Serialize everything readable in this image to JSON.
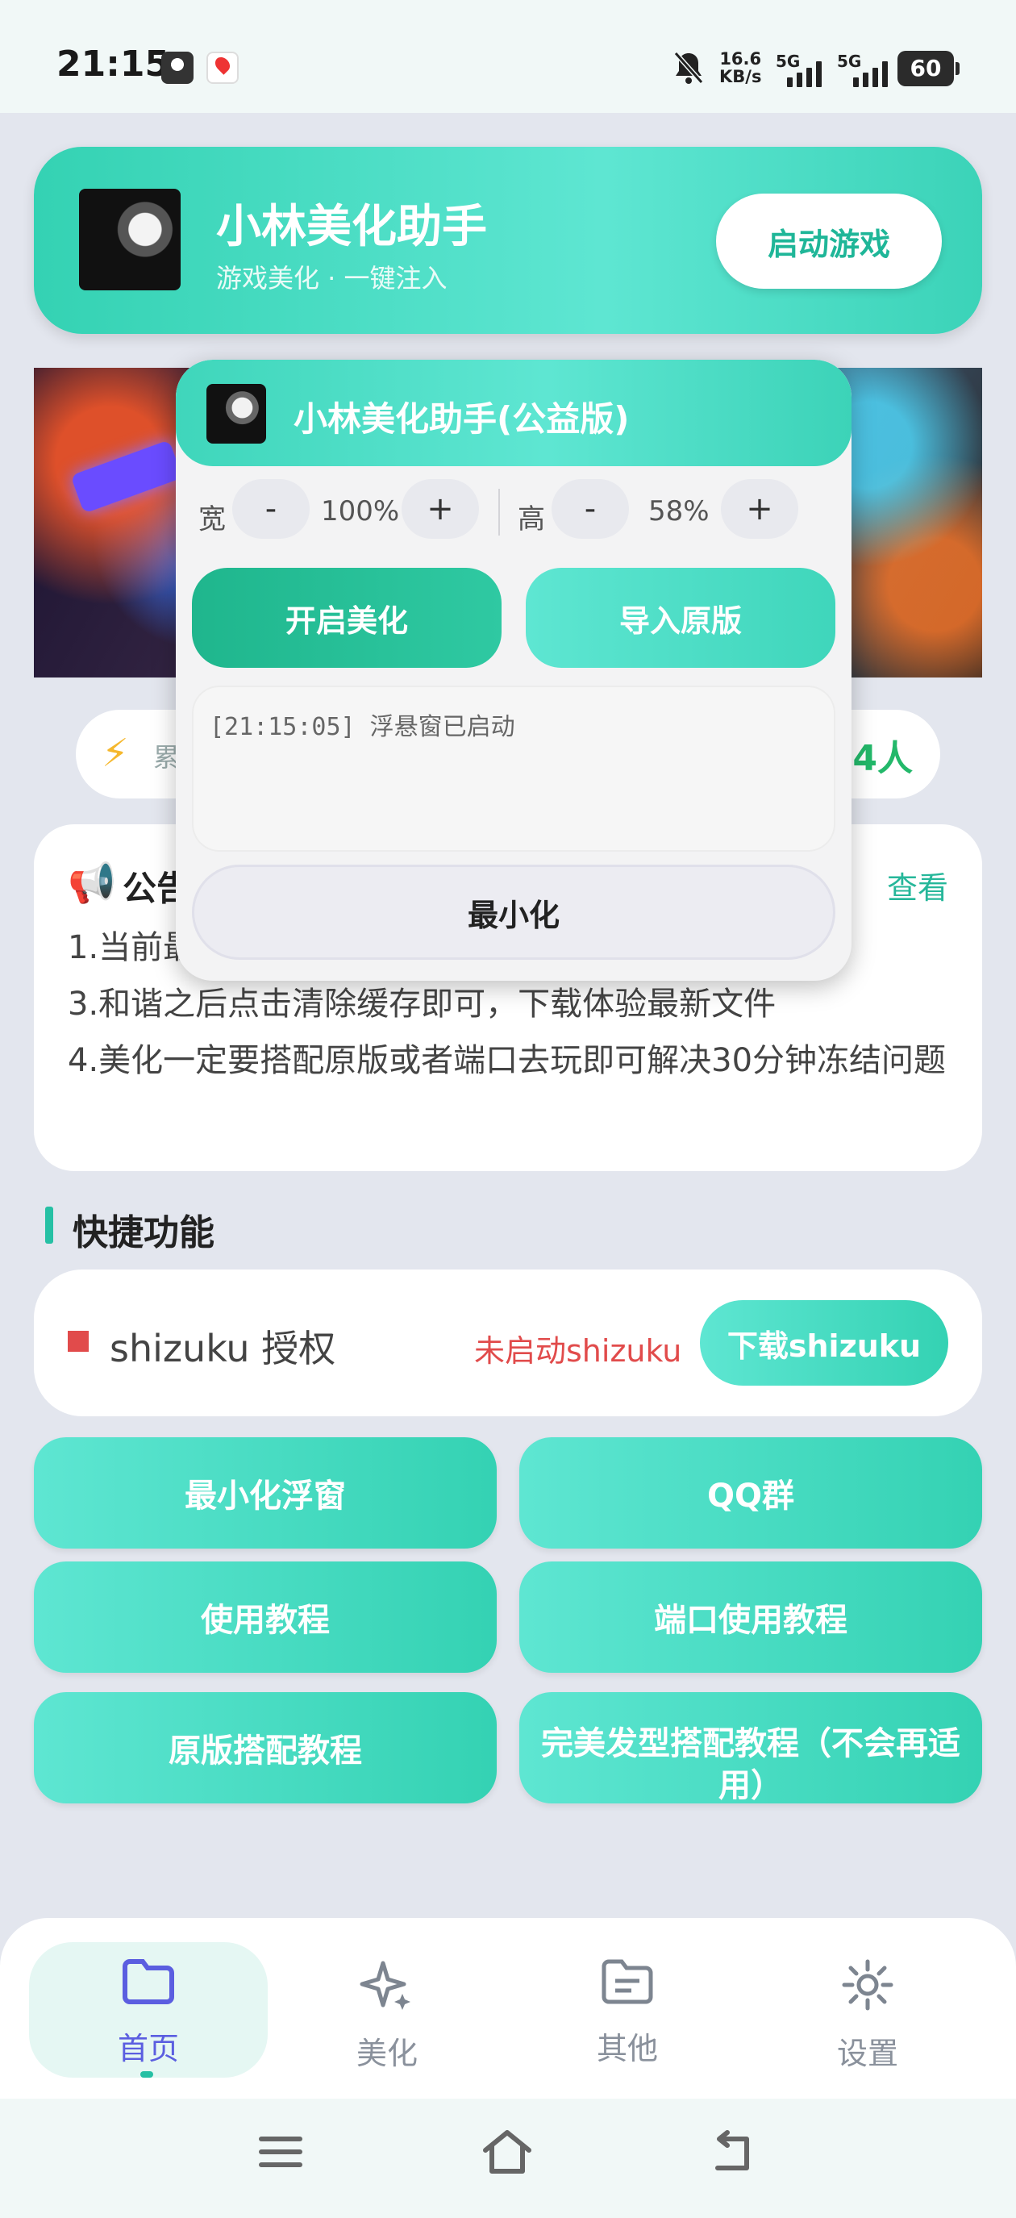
{
  "status_bar": {
    "time": "21:15",
    "net_speed_value": "16.6",
    "net_speed_unit": "KB/s",
    "net_type_1": "5G",
    "net_type_2": "5G",
    "battery": "60"
  },
  "header": {
    "title": "小林美化助手",
    "subtitle": "游戏美化 · 一键注入",
    "launch_button": "启动游戏"
  },
  "online": {
    "icon": "⚡",
    "label": "累",
    "count": "4人"
  },
  "notice": {
    "icon": "📢",
    "title": "公告",
    "view_link": "查看",
    "lines": [
      "1.当前最",
      "3.和谐之后点击清除缓存即可，下载体验最新文件",
      "4.美化一定要搭配原版或者端口去玩即可解决30分钟冻结问题"
    ]
  },
  "quick": {
    "title": "快捷功能",
    "shizuku_label": "shizuku 授权",
    "shizuku_status": "未启动shizuku",
    "shizuku_download": "下载shizuku",
    "buttons": {
      "minimize_float": "最小化浮窗",
      "qq_group": "QQ群",
      "usage_tutorial": "使用教程",
      "port_tutorial": "端口使用教程",
      "original_tutorial": "原版搭配教程",
      "perfect_hair_tutorial": "完美发型搭配教程（不会再适用）"
    }
  },
  "float_window": {
    "title": "小林美化助手(公益版)",
    "width_label": "宽",
    "width_value": "100%",
    "height_label": "高",
    "height_value": "58%",
    "minus": "-",
    "plus": "+",
    "enable_button": "开启美化",
    "import_button": "导入原版",
    "log": "[21:15:05] 浮悬窗已启动",
    "minimize_button": "最小化"
  },
  "bottom_nav": {
    "items": [
      {
        "label": "首页",
        "icon": "folder-icon"
      },
      {
        "label": "美化",
        "icon": "sparkle-icon"
      },
      {
        "label": "其他",
        "icon": "document-folder-icon"
      },
      {
        "label": "设置",
        "icon": "gear-icon"
      }
    ]
  },
  "colors": {
    "accent": "#34d2b3",
    "warning": "#e14b4b",
    "online": "#23b86a",
    "nav_active": "#5b5ee0"
  }
}
